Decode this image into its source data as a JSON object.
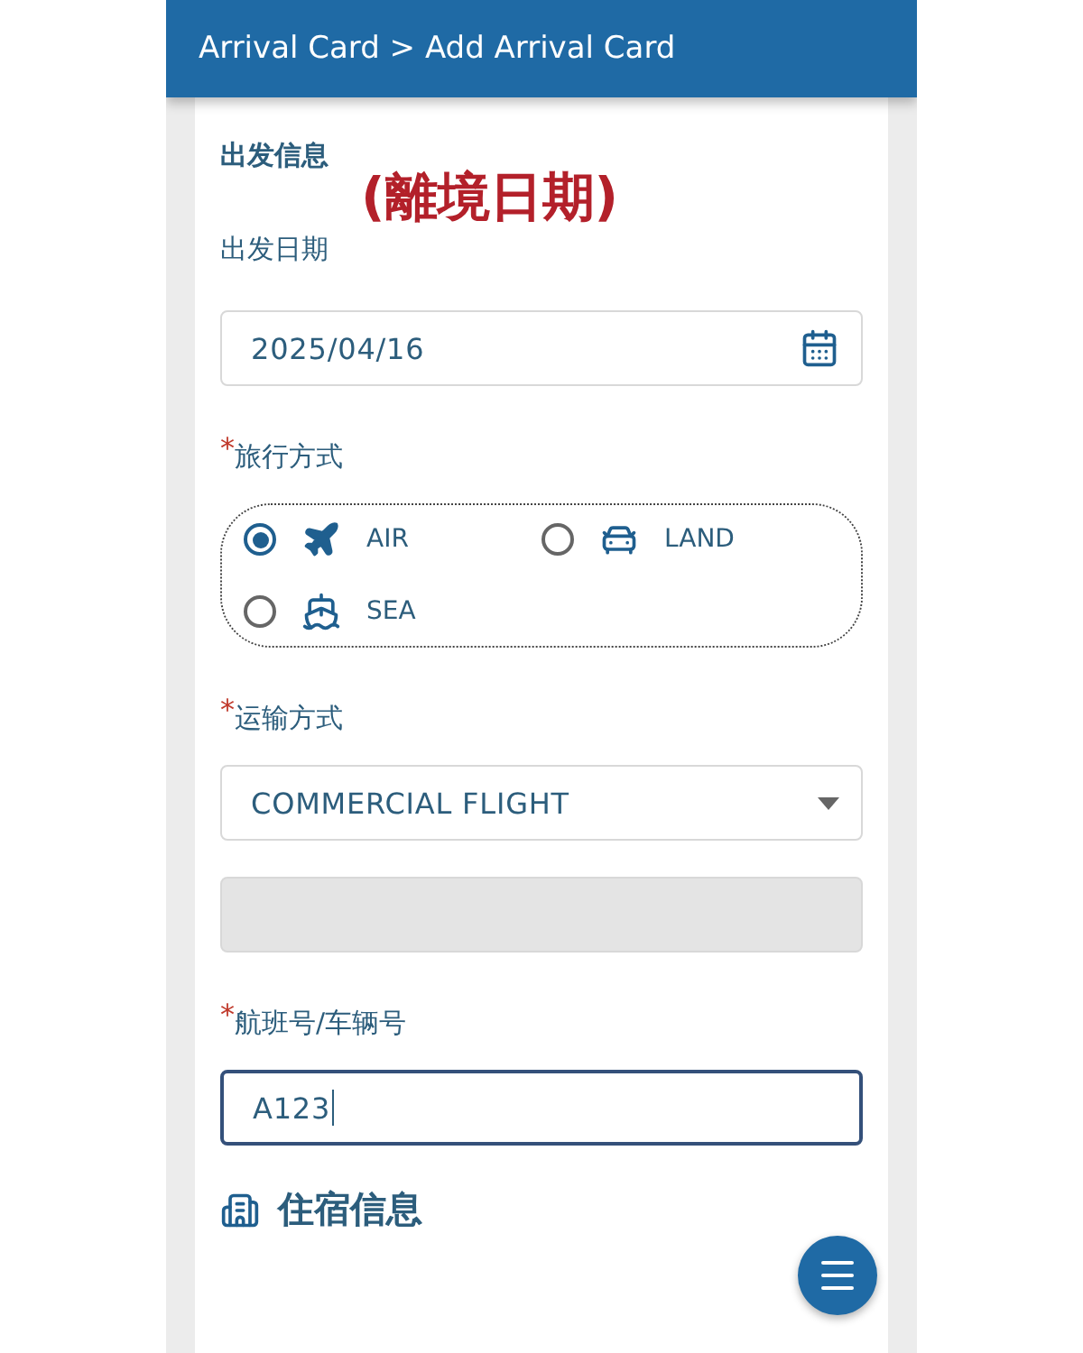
{
  "header": {
    "title": "Arrival Card > Add Arrival Card"
  },
  "departure": {
    "section_title": "出发信息",
    "annotation": "(離境日期)",
    "date_label": "出发日期",
    "date_value": "2025/04/16"
  },
  "fields": [
    {
      "kind": "radio_group",
      "marker": "*",
      "label": "旅行方式",
      "options": [
        {
          "label": "AIR",
          "kind": "plane",
          "selected": true
        },
        {
          "label": "LAND",
          "kind": "car",
          "selected": false
        },
        {
          "label": "SEA",
          "kind": "ship",
          "selected": false
        }
      ]
    },
    {
      "kind": "select",
      "marker": "*",
      "label": "运输方式",
      "value": "COMMERCIAL FLIGHT"
    },
    {
      "kind": "blank",
      "disabled": true
    },
    {
      "kind": "text",
      "marker": "*",
      "label": "航班号/车辆号",
      "value": "A123",
      "focused": true
    }
  ],
  "next_section": {
    "title": "住宿信息"
  }
}
